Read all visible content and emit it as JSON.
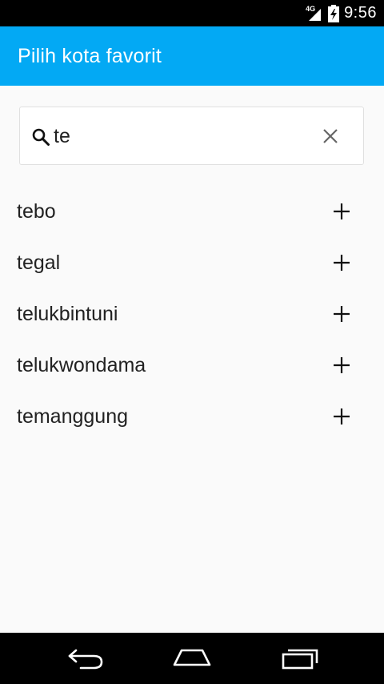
{
  "status_bar": {
    "network": "4G",
    "time": "9:56",
    "icons": [
      "signal-icon",
      "battery-icon"
    ]
  },
  "app_bar": {
    "title": "Pilih kota favorit"
  },
  "search": {
    "value": "te",
    "icons": [
      "search-icon",
      "clear-icon"
    ]
  },
  "cities": [
    {
      "name": "tebo"
    },
    {
      "name": "tegal"
    },
    {
      "name": "telukbintuni"
    },
    {
      "name": "telukwondama"
    },
    {
      "name": "temanggung"
    }
  ],
  "nav_bar": {
    "icons": [
      "back-icon",
      "home-icon",
      "recents-icon"
    ]
  }
}
